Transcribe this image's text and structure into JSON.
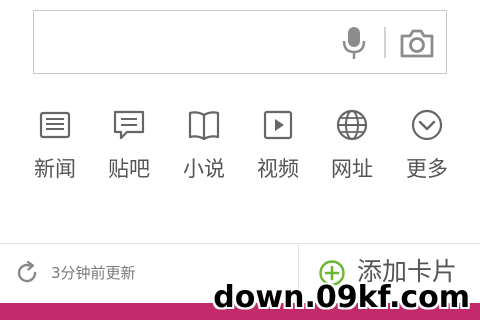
{
  "search": {
    "placeholder": ""
  },
  "nav_items": [
    {
      "label": "新闻",
      "icon": "news-icon"
    },
    {
      "label": "贴吧",
      "icon": "forum-icon"
    },
    {
      "label": "小说",
      "icon": "book-icon"
    },
    {
      "label": "视频",
      "icon": "video-icon"
    },
    {
      "label": "网址",
      "icon": "globe-icon"
    },
    {
      "label": "更多",
      "icon": "chevron-down-icon"
    }
  ],
  "feed": {
    "update_text": "3分钟前更新",
    "add_card_label": "添加卡片"
  },
  "watermark": "down.09kf.com",
  "colors": {
    "accent_green": "#6bb52f",
    "banner_pink": "#c22a6b",
    "icon_gray": "#666666"
  }
}
